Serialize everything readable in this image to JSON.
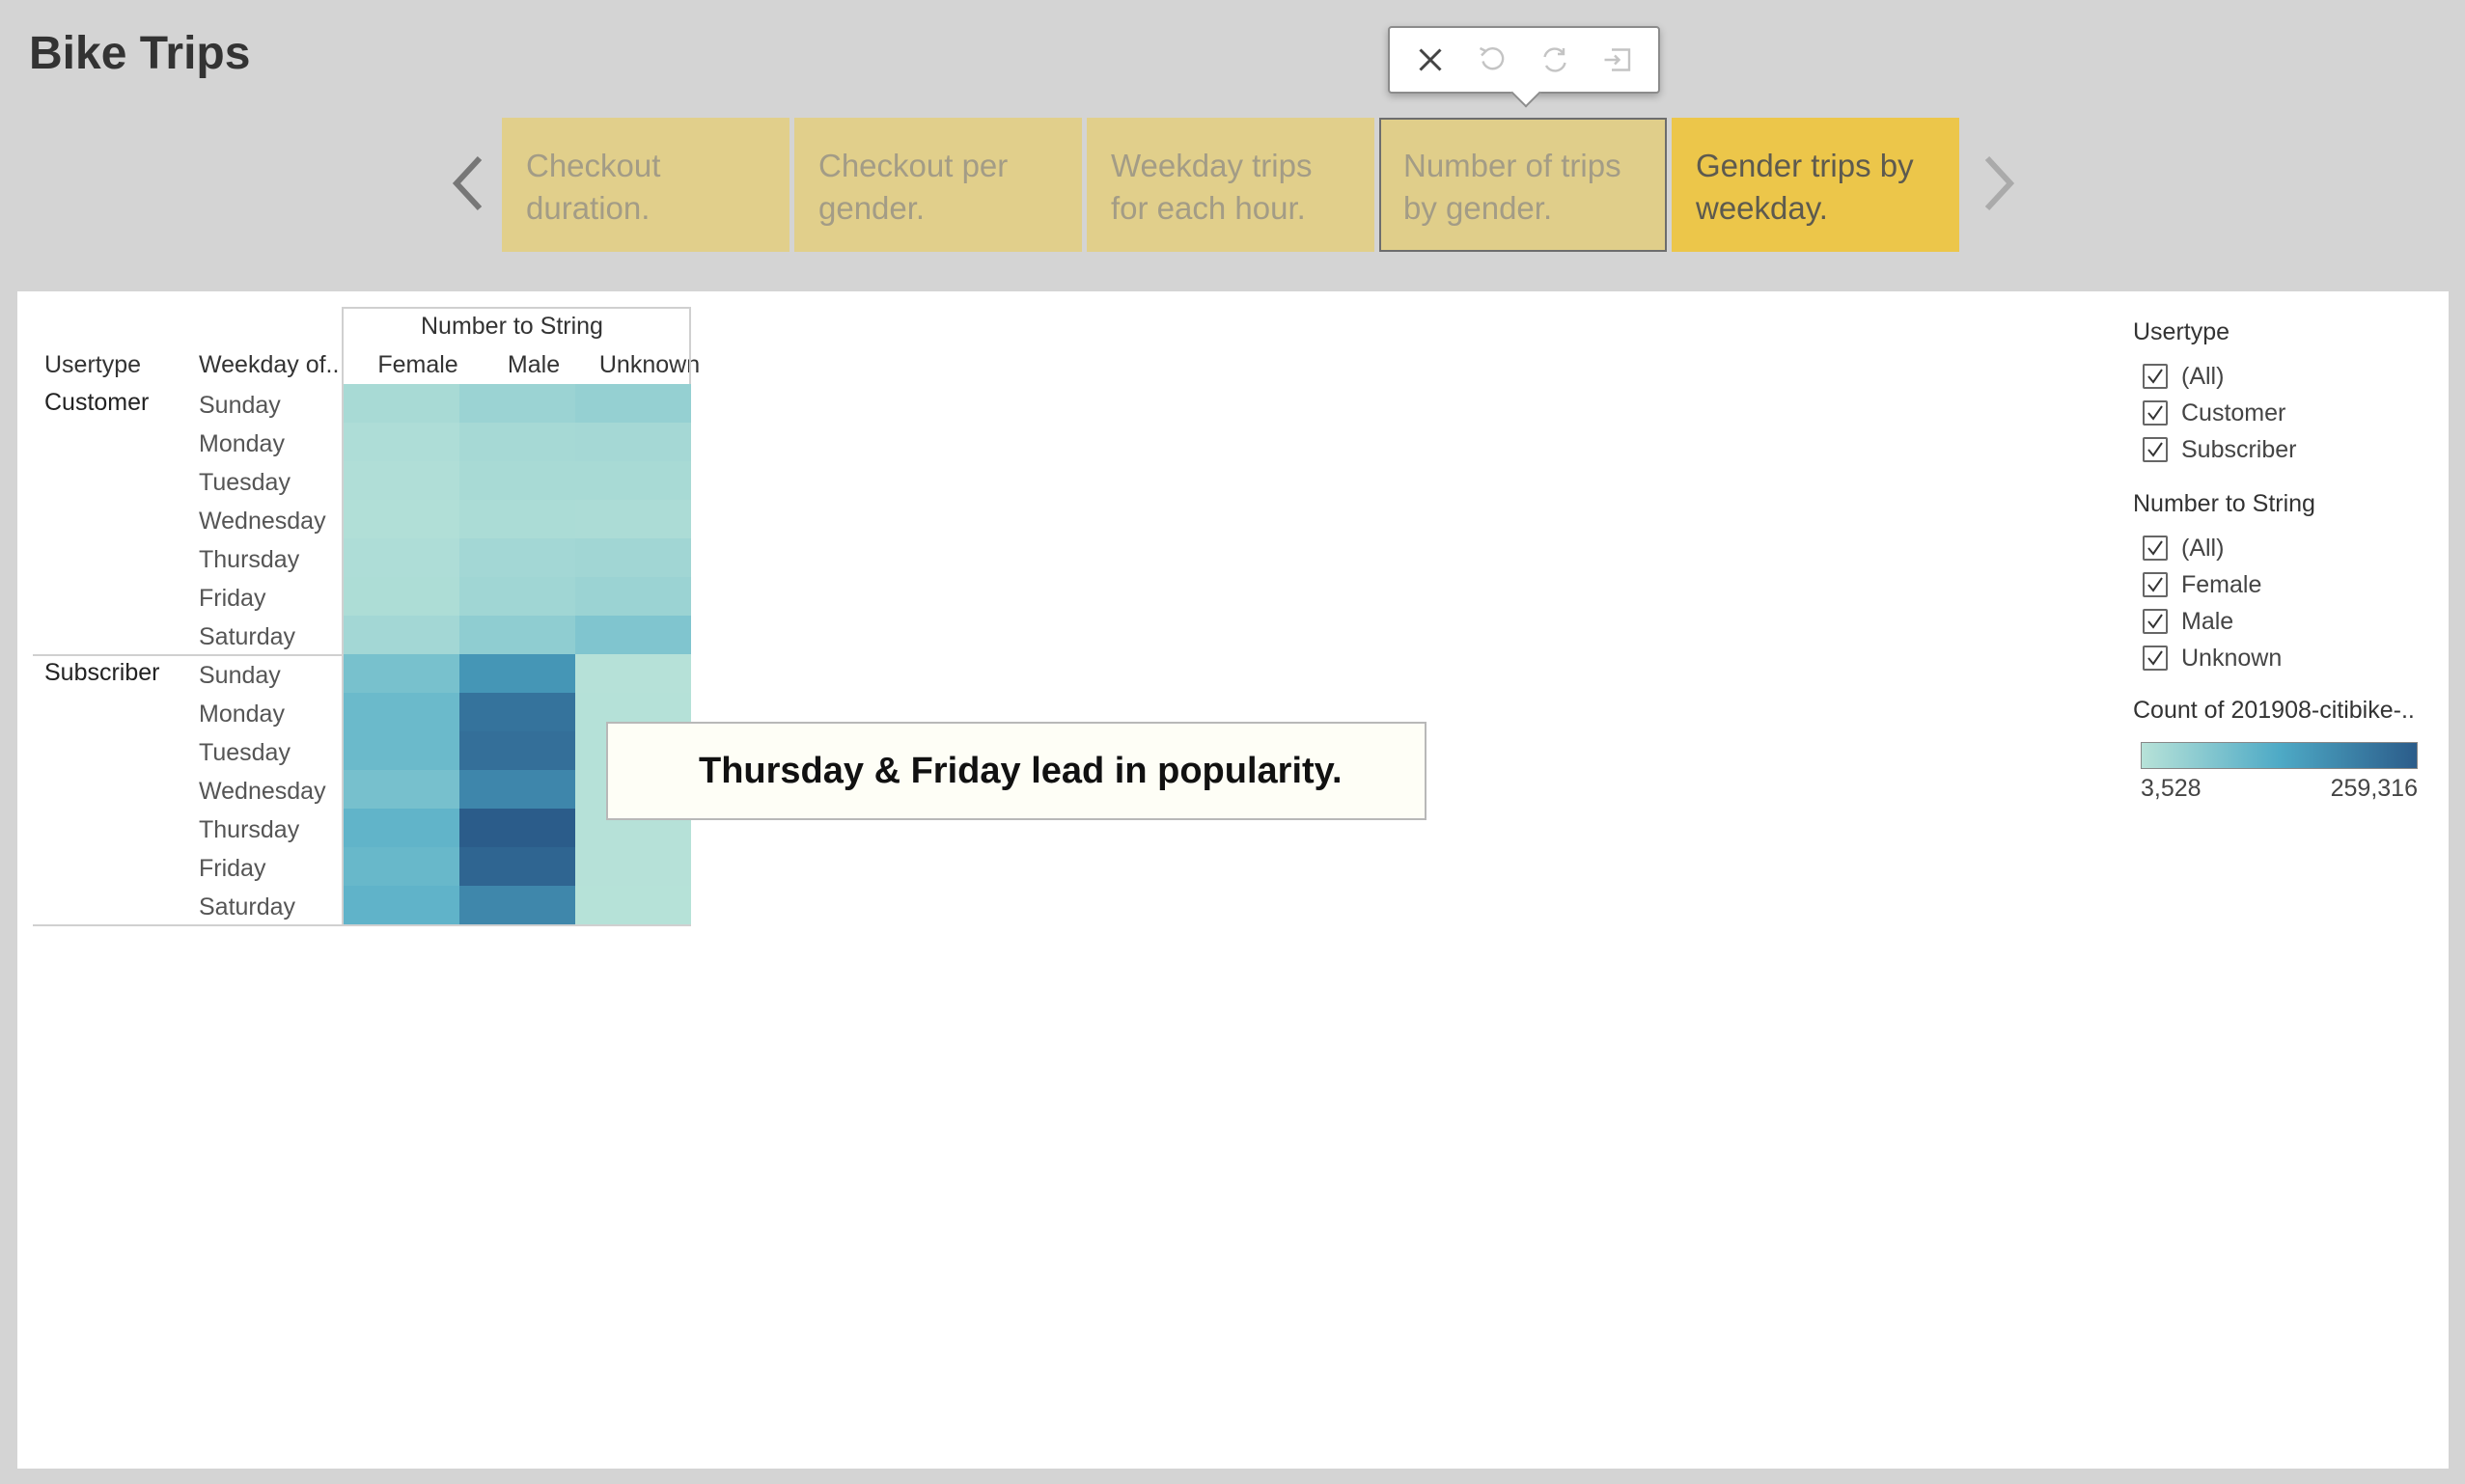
{
  "app": {
    "title": "Bike Trips"
  },
  "toolbar": {
    "buttons": [
      {
        "name": "close-icon",
        "enabled": true
      },
      {
        "name": "undo-icon",
        "enabled": false
      },
      {
        "name": "redo-icon",
        "enabled": false
      },
      {
        "name": "exit-icon",
        "enabled": false
      }
    ]
  },
  "story": {
    "points": [
      {
        "label": "Checkout duration."
      },
      {
        "label": "Checkout per gender."
      },
      {
        "label": "Weekday trips for each hour."
      },
      {
        "label": "Number of trips by gender."
      },
      {
        "label": "Gender trips by weekday."
      }
    ],
    "active_index": 4,
    "outlined_index": 3
  },
  "crosstab": {
    "column_group_header": "Number to String",
    "row_headers": [
      "Usertype",
      "Weekday of.."
    ],
    "columns": [
      "Female",
      "Male",
      "Unknown"
    ],
    "groups": [
      {
        "label": "Customer",
        "days": [
          "Sunday",
          "Monday",
          "Tuesday",
          "Wednesday",
          "Thursday",
          "Friday",
          "Saturday"
        ]
      },
      {
        "label": "Subscriber",
        "days": [
          "Sunday",
          "Monday",
          "Tuesday",
          "Wednesday",
          "Thursday",
          "Friday",
          "Saturday"
        ]
      }
    ]
  },
  "chart_data": {
    "type": "heatmap",
    "rows": [
      "Customer / Sunday",
      "Customer / Monday",
      "Customer / Tuesday",
      "Customer / Wednesday",
      "Customer / Thursday",
      "Customer / Friday",
      "Customer / Saturday",
      "Subscriber / Sunday",
      "Subscriber / Monday",
      "Subscriber / Tuesday",
      "Subscriber / Wednesday",
      "Subscriber / Thursday",
      "Subscriber / Friday",
      "Subscriber / Saturday"
    ],
    "columns": [
      "Female",
      "Male",
      "Unknown"
    ],
    "values": [
      [
        22000,
        38000,
        45000
      ],
      [
        14000,
        24000,
        26000
      ],
      [
        12000,
        22000,
        22000
      ],
      [
        11000,
        18000,
        17000
      ],
      [
        14000,
        28000,
        30000
      ],
      [
        16000,
        32000,
        38000
      ],
      [
        28000,
        52000,
        70000
      ],
      [
        80000,
        165000,
        5000
      ],
      [
        96000,
        222000,
        5500
      ],
      [
        96000,
        228000,
        5500
      ],
      [
        82000,
        190000,
        5000
      ],
      [
        108000,
        259316,
        5000
      ],
      [
        100000,
        245000,
        5200
      ],
      [
        110000,
        188000,
        4500
      ]
    ],
    "colorscale": {
      "min": 3528,
      "max": 259316,
      "low_color": "#b7e2d8",
      "mid_color": "#4eaac6",
      "high_color": "#2b5c8a"
    }
  },
  "annotation": {
    "text": "Thursday & Friday lead in popularity."
  },
  "filters": [
    {
      "title": "Usertype",
      "items": [
        "(All)",
        "Customer",
        "Subscriber"
      ]
    },
    {
      "title": "Number to String",
      "items": [
        "(All)",
        "Female",
        "Male",
        "Unknown"
      ]
    }
  ],
  "legend": {
    "title": "Count of 201908-citibike-..",
    "min_label": "3,528",
    "max_label": "259,316"
  }
}
